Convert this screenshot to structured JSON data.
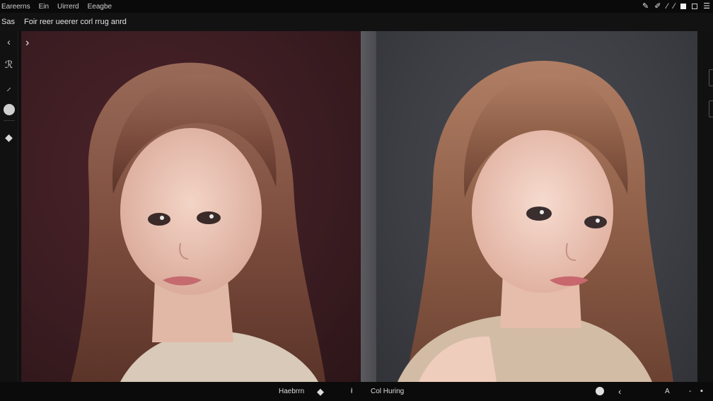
{
  "menubar": {
    "items": [
      "Eareerns",
      "Ein",
      "Uirrerd",
      "Eeagbe"
    ]
  },
  "titlebar": {
    "app_short": "Sas",
    "doc_title": "Foir reer ueerer corl rrug anrd"
  },
  "leftrail": {
    "tools": [
      "back-arrow",
      "lasso-tool",
      "pen-tool",
      "color-circle",
      "eraser-tool"
    ]
  },
  "canvas": {
    "left_background": "#3a1c21",
    "right_background": "#3d3e44",
    "nav_arrow": "›"
  },
  "bottombar": {
    "left_label": "Haebrrn",
    "separator": "ł",
    "right_label": "Col Huring",
    "end_glyph": "A",
    "dash": "-"
  },
  "colors": {
    "accent": "#e0e0e0",
    "hair": "#8a5a48",
    "skin": "#e9c2b0"
  }
}
